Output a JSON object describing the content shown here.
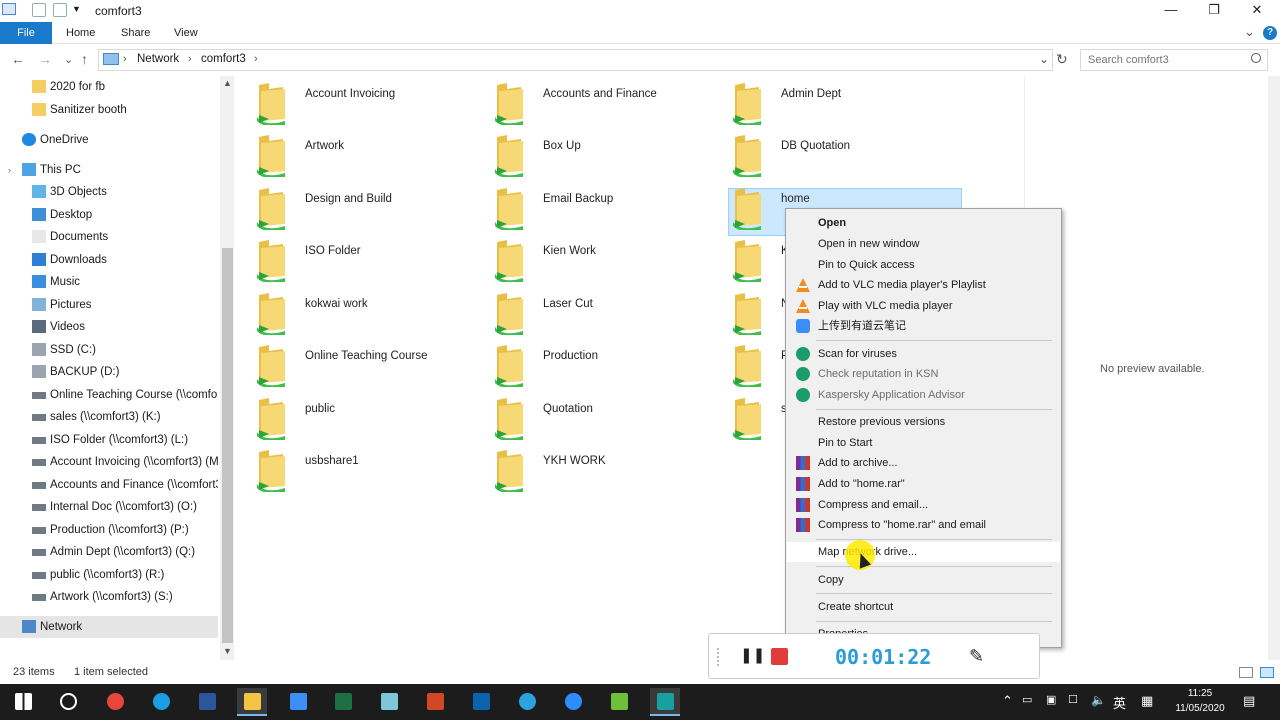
{
  "window": {
    "title": "comfort3",
    "minimize": "—",
    "restore": "❐",
    "close": "✕"
  },
  "ribbon": {
    "tabs": [
      "File",
      "Home",
      "Share",
      "View"
    ],
    "expand": "⌄",
    "help": "?"
  },
  "address": {
    "back": "←",
    "forward": "→",
    "recent": "⌄",
    "up": "↑",
    "crumbs": [
      "Network",
      "comfort3"
    ],
    "sep": "›",
    "dropdown": "⌄",
    "refresh": "↻",
    "search_placeholder": "Search comfort3"
  },
  "nav": {
    "items": [
      {
        "label": "2020 for fb",
        "icon": "folder-icon"
      },
      {
        "label": "Sanitizer booth",
        "icon": "folder-icon"
      },
      {
        "label": "OneDrive",
        "icon": "onedrive-icon"
      },
      {
        "label": "This PC",
        "icon": "pc-icon"
      },
      {
        "label": "3D Objects",
        "icon": "3d-objects-icon"
      },
      {
        "label": "Desktop",
        "icon": "desktop-icon"
      },
      {
        "label": "Documents",
        "icon": "documents-icon"
      },
      {
        "label": "Downloads",
        "icon": "downloads-icon"
      },
      {
        "label": "Music",
        "icon": "music-icon"
      },
      {
        "label": "Pictures",
        "icon": "pictures-icon"
      },
      {
        "label": "Videos",
        "icon": "videos-icon"
      },
      {
        "label": "SSD (C:)",
        "icon": "drive-icon"
      },
      {
        "label": "BACKUP (D:)",
        "icon": "drive-icon"
      },
      {
        "label": "Online Teaching Course (\\\\comfor",
        "icon": "network-drive-icon"
      },
      {
        "label": "sales (\\\\comfort3) (K:)",
        "icon": "network-drive-icon"
      },
      {
        "label": "ISO Folder (\\\\comfort3) (L:)",
        "icon": "network-drive-icon"
      },
      {
        "label": "Account Invoicing (\\\\comfort3) (M",
        "icon": "network-drive-icon"
      },
      {
        "label": "Accounts and Finance (\\\\comfort3",
        "icon": "network-drive-icon"
      },
      {
        "label": "Internal Doc (\\\\comfort3) (O:)",
        "icon": "network-drive-icon"
      },
      {
        "label": "Production (\\\\comfort3) (P:)",
        "icon": "network-drive-icon"
      },
      {
        "label": "Admin Dept (\\\\comfort3) (Q:)",
        "icon": "network-drive-icon"
      },
      {
        "label": "public (\\\\comfort3) (R:)",
        "icon": "network-drive-icon"
      },
      {
        "label": "Artwork (\\\\comfort3) (S:)",
        "icon": "network-drive-icon"
      },
      {
        "label": "Network",
        "icon": "network-icon"
      }
    ]
  },
  "folders": {
    "col1": [
      "Account Invoicing",
      "Artwork",
      "Design and Build",
      "ISO Folder",
      "kokwai work",
      "Online Teaching Course",
      "public",
      "usbshare1"
    ],
    "col2": [
      "Accounts and Finance",
      "Box Up",
      "Email Backup",
      "Kien Work",
      "Laser Cut",
      "Production",
      "Quotation",
      "YKH WORK"
    ],
    "col3": [
      "Admin Dept",
      "DB Quotation",
      "home",
      "K",
      "N",
      "P",
      "s"
    ]
  },
  "preview": {
    "text": "No preview available."
  },
  "status": {
    "count": "23 items",
    "selected": "1 item selected"
  },
  "context_menu": {
    "items": [
      {
        "label": "Open",
        "bold": true,
        "icon": ""
      },
      {
        "label": "Open in new window",
        "icon": ""
      },
      {
        "label": "Pin to Quick access",
        "icon": ""
      },
      {
        "label": "Add to VLC media player's Playlist",
        "icon": "vlc-icon"
      },
      {
        "label": "Play with VLC media player",
        "icon": "vlc-icon"
      },
      {
        "label": "上传到有道云笔记",
        "icon": "youdao-icon"
      },
      {
        "label": "Scan for viruses",
        "icon": "kaspersky-icon"
      },
      {
        "label": "Check reputation in KSN",
        "icon": "kaspersky-icon",
        "disabled": true
      },
      {
        "label": "Kaspersky Application Advisor",
        "icon": "kaspersky-icon",
        "disabled": true
      },
      {
        "label": "Restore previous versions",
        "icon": ""
      },
      {
        "label": "Pin to Start",
        "icon": ""
      },
      {
        "label": "Add to archive...",
        "icon": "winrar-icon"
      },
      {
        "label": "Add to \"home.rar\"",
        "icon": "winrar-icon"
      },
      {
        "label": "Compress and email...",
        "icon": "winrar-icon"
      },
      {
        "label": "Compress to \"home.rar\" and email",
        "icon": "winrar-icon"
      },
      {
        "label": "Map network drive...",
        "icon": ""
      },
      {
        "label": "Copy",
        "icon": ""
      },
      {
        "label": "Create shortcut",
        "icon": ""
      },
      {
        "label": "Properties",
        "icon": ""
      }
    ]
  },
  "recorder": {
    "time": "00:01:22",
    "pause": "❚❚",
    "stop": "■",
    "draw": "✎"
  },
  "taskbar": {
    "apps": [
      "start-icon",
      "search-icon",
      "chrome-icon",
      "edge-icon",
      "word-icon",
      "file-explorer-icon",
      "youdao-icon",
      "excel-icon",
      "notepad-icon",
      "powerpoint-icon",
      "outlook-icon",
      "telegram-icon",
      "zoom-icon",
      "app-icon",
      "screencast-icon"
    ],
    "ime": "英",
    "time": "11:25",
    "date": "11/05/2020"
  },
  "colors": {
    "accent": "#1979ca",
    "selection": "#cce8ff",
    "folder": "#f3d16b",
    "network_green": "#3fbf4a",
    "taskbar": "#1c1c1c"
  }
}
